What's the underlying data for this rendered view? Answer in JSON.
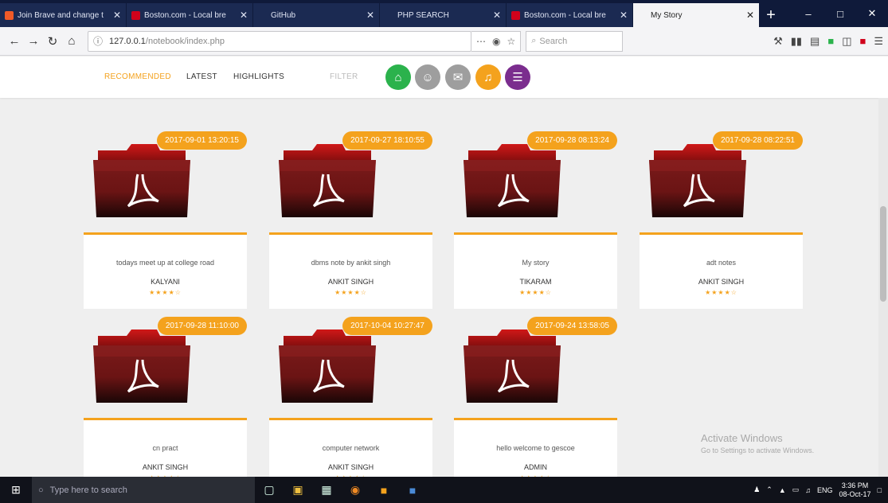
{
  "browser": {
    "tabs": [
      {
        "title": "Join Brave and change t",
        "fav": "#f05a28",
        "active": false
      },
      {
        "title": "Boston.com - Local bre",
        "fav": "#d0021b",
        "active": false
      },
      {
        "title": "GitHub",
        "fav": "#1b2a52",
        "active": false
      },
      {
        "title": "PHP SEARCH",
        "fav": "#1b2a52",
        "active": false
      },
      {
        "title": "Boston.com - Local bre",
        "fav": "#d0021b",
        "active": false
      },
      {
        "title": "My Story",
        "fav": "#f4f4f6",
        "active": true
      }
    ],
    "new_tab": "+",
    "url_host": "127.0.0.1",
    "url_path": "/notebook/index.php",
    "search_placeholder": "Search"
  },
  "site_nav": {
    "links": [
      {
        "label": "RECOMMENDED",
        "color": "#f4a21d"
      },
      {
        "label": "LATEST",
        "color": "#333333"
      },
      {
        "label": "HIGHLIGHTS",
        "color": "#333333"
      },
      {
        "label": "FILTER",
        "color": "#bbbbbb"
      }
    ],
    "circles": [
      {
        "icon": "home-icon",
        "glyph": "⌂",
        "color": "#2bb24c"
      },
      {
        "icon": "user-icon",
        "glyph": "☺",
        "color": "#9e9e9e"
      },
      {
        "icon": "mail-icon",
        "glyph": "✉",
        "color": "#9e9e9e"
      },
      {
        "icon": "music-icon",
        "glyph": "♫",
        "color": "#f4a21d"
      },
      {
        "icon": "list-icon",
        "glyph": "☰",
        "color": "#7b2d8e"
      }
    ]
  },
  "cards": [
    {
      "date": "2017-09-01 13:20:15",
      "title": "todays meet up at college road",
      "author": "KALYANI",
      "stars": "★★★★☆"
    },
    {
      "date": "2017-09-27 18:10:55",
      "title": "dbms note by ankit singh",
      "author": "ANKIT SINGH",
      "stars": "★★★★☆"
    },
    {
      "date": "2017-09-28 08:13:24",
      "title": "My story",
      "author": "TIKARAM",
      "stars": "★★★★☆"
    },
    {
      "date": "2017-09-28 08:22:51",
      "title": "adt notes",
      "author": "ANKIT SINGH",
      "stars": "★★★★☆"
    },
    {
      "date": "2017-09-28 11:10:00",
      "title": "cn pract",
      "author": "ANKIT SINGH",
      "stars": "★★★★☆"
    },
    {
      "date": "2017-10-04 10:27:47",
      "title": "computer network",
      "author": "ANKIT SINGH",
      "stars": "★★★★☆"
    },
    {
      "date": "2017-09-24 13:58:05",
      "title": "hello welcome to gescoe",
      "author": "ADMIN",
      "stars": "★★★★☆"
    }
  ],
  "watermark": {
    "line1": "Activate Windows",
    "line2": "Go to Settings to activate Windows."
  },
  "taskbar": {
    "search_placeholder": "Type here to search",
    "time": "3:36 PM",
    "date": "08-Oct-17",
    "lang": "ENG"
  },
  "colors": {
    "accent": "#f4a21d",
    "folder": "#6b1414"
  }
}
